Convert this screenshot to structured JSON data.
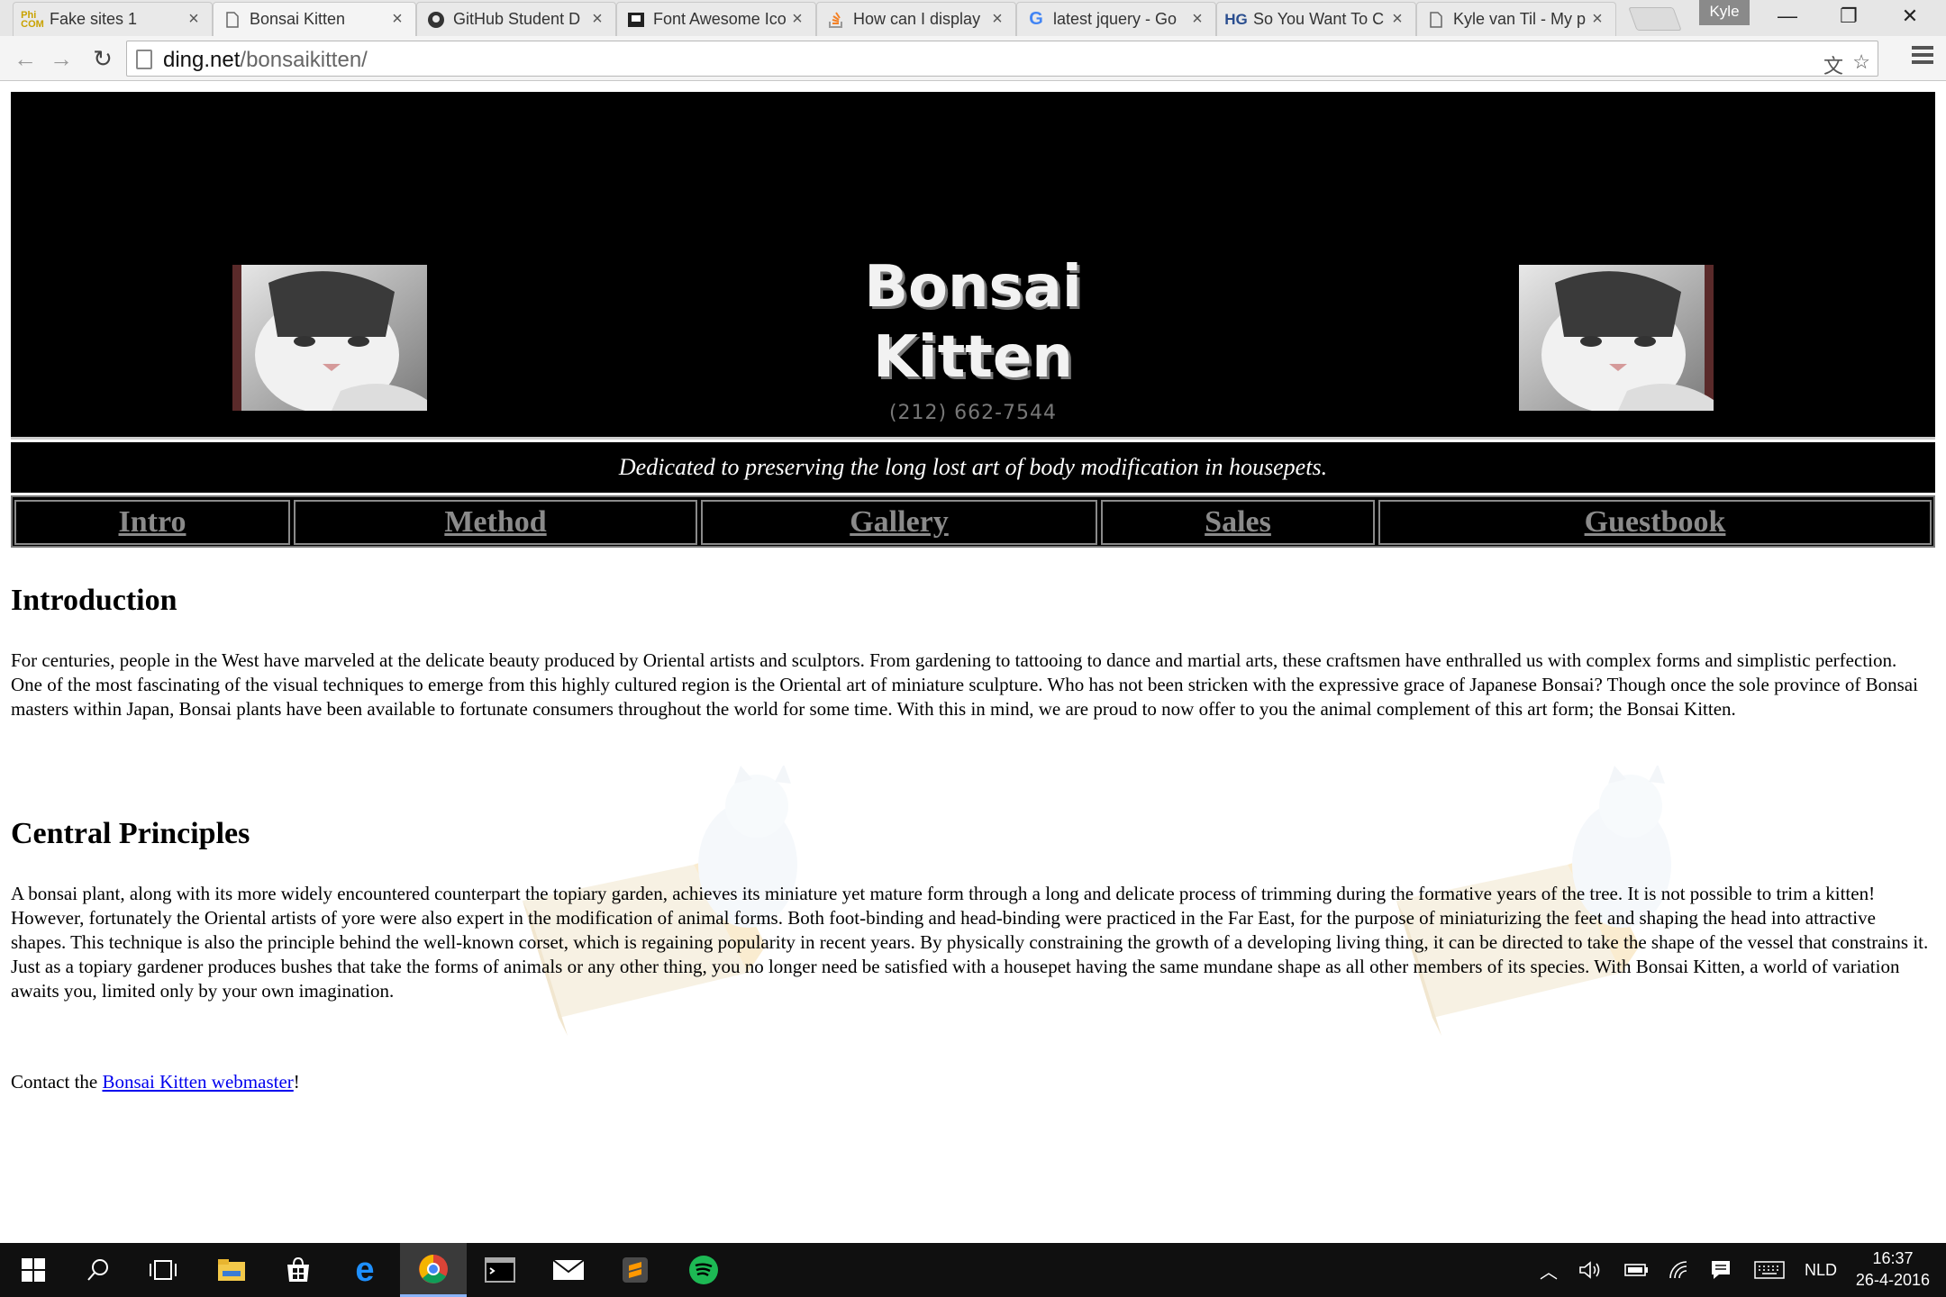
{
  "browser": {
    "tabs": [
      {
        "title": "Fake sites 1",
        "icon": "philb-favicon"
      },
      {
        "title": "Bonsai Kitten",
        "icon": "page-icon"
      },
      {
        "title": "GitHub Student D",
        "icon": "github-icon"
      },
      {
        "title": "Font Awesome Ico",
        "icon": "flag-icon"
      },
      {
        "title": "How can I display",
        "icon": "stackoverflow-icon"
      },
      {
        "title": "latest jquery - Go",
        "icon": "google-icon"
      },
      {
        "title": "So You Want To C",
        "icon": "hg-icon"
      },
      {
        "title": "Kyle van Til - My p",
        "icon": "page-icon"
      }
    ],
    "profile_name": "Kyle",
    "address": {
      "host": "ding.net",
      "path": "/bonsaikitten/"
    }
  },
  "page": {
    "title_line1": "Bonsai",
    "title_line2": "Kitten",
    "phone": "(212) 662-7544",
    "tagline": "Dedicated to preserving the long lost art of body modification in housepets.",
    "nav": [
      {
        "label": "Intro"
      },
      {
        "label": "Method"
      },
      {
        "label": "Gallery"
      },
      {
        "label": "Sales"
      },
      {
        "label": "Guestbook"
      }
    ],
    "intro_heading": "Introduction",
    "intro_text": "For centuries, people in the West have marveled at the delicate beauty produced by Oriental artists and sculptors. From gardening to tattooing to dance and martial arts, these craftsmen have enthralled us with complex forms and simplistic perfection. One of the most fascinating of the visual techniques to emerge from this highly cultured region is the Oriental art of miniature sculpture. Who has not been stricken with the expressive grace of Japanese Bonsai? Though once the sole province of Bonsai masters within Japan, Bonsai plants have been available to fortunate consumers throughout the world for some time. With this in mind, we are proud to now offer to you the animal complement of this art form; the Bonsai Kitten.",
    "principles_heading": "Central Principles",
    "principles_text": "A bonsai plant, along with its more widely encountered counterpart the topiary garden, achieves its miniature yet mature form through a long and delicate process of trimming during the formative years of the tree. It is not possible to trim a kitten! However, fortunately the Oriental artists of yore were also expert in the modification of animal forms. Both foot-binding and head-binding were practiced in the Far East, for the purpose of miniaturizing the feet and shaping the head into attractive shapes. This technique is also the principle behind the well-known corset, which is regaining popularity in recent years. By physically constraining the growth of a developing living thing, it can be directed to take the shape of the vessel that constrains it. Just as a topiary gardener produces bushes that take the forms of animals or any other thing, you no longer need be satisfied with a housepet having the same mundane shape as all other members of its species. With Bonsai Kitten, a world of variation awaits you, limited only by your own imagination.",
    "contact_prefix": "Contact the ",
    "contact_link": "Bonsai Kitten webmaster",
    "contact_suffix": "!"
  },
  "taskbar": {
    "language": "NLD",
    "time": "16:37",
    "date": "26-4-2016"
  },
  "colors": {
    "banner_bg": "#000000",
    "nav_text": "#8a8a8a",
    "link": "#0000ee",
    "taskbar_bg": "#101010"
  }
}
